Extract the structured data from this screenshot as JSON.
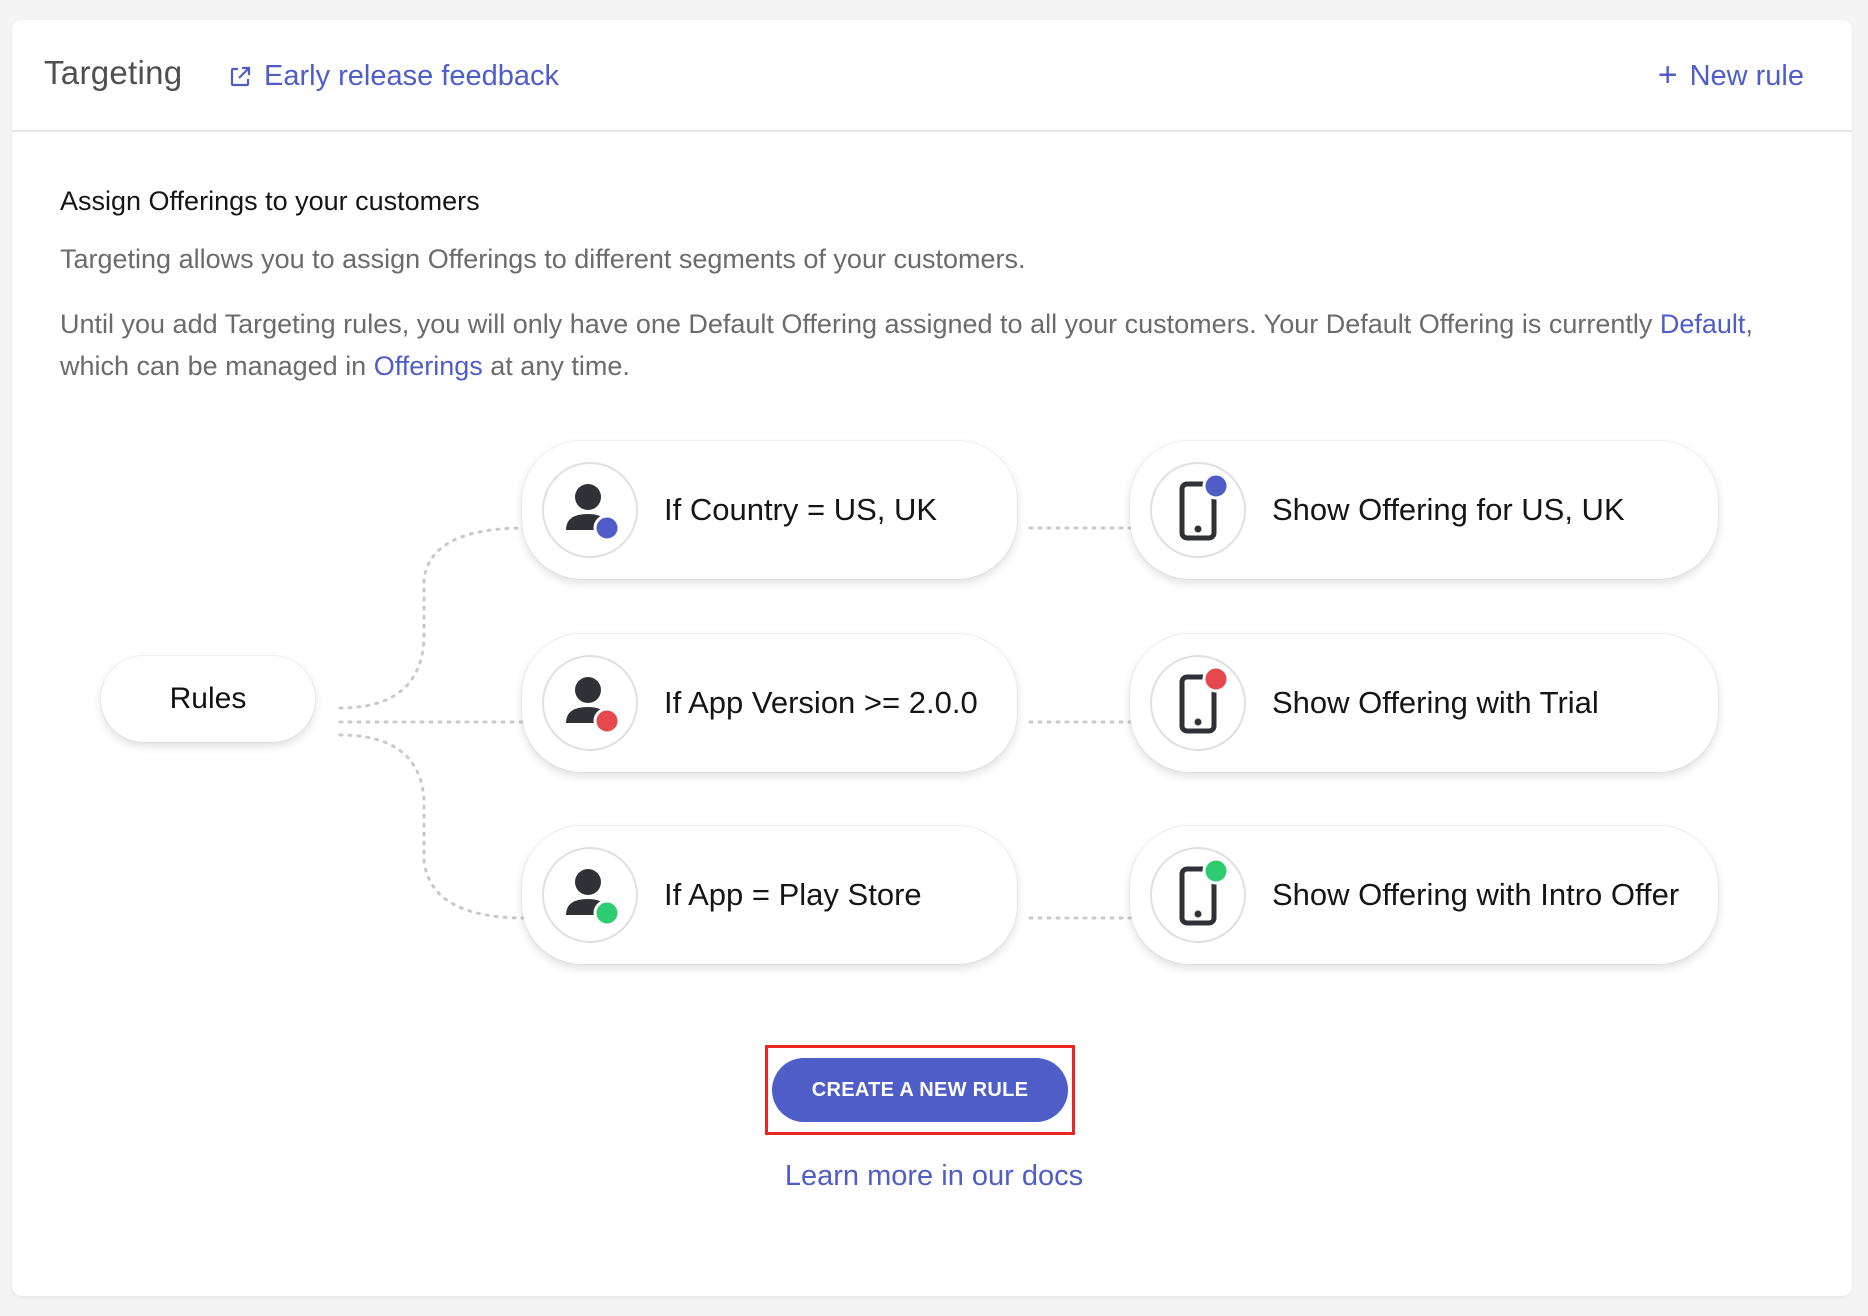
{
  "header": {
    "title": "Targeting",
    "feedback_label": "Early release feedback",
    "new_rule_label": "New rule"
  },
  "intro": {
    "title": "Assign Offerings to your customers",
    "paragraph1": "Targeting allows you to assign Offerings to different segments of your customers.",
    "paragraph2_before": "Until you add Targeting rules, you will only have one Default Offering assigned to all your customers. Your Default Offering is currently ",
    "default_link": "Default",
    "paragraph2_middle": ", which can be managed in ",
    "offerings_link": "Offerings",
    "paragraph2_after": " at any time."
  },
  "diagram": {
    "root_label": "Rules",
    "rows": [
      {
        "condition": "If Country = US, UK",
        "result": "Show Offering for US, UK",
        "dot_color": "#4f5dc9"
      },
      {
        "condition": "If App Version >= 2.0.0",
        "result": "Show Offering with Trial",
        "dot_color": "#e5484d"
      },
      {
        "condition": "If App = Play Store",
        "result": "Show Offering with Intro Offer",
        "dot_color": "#2ecc71"
      }
    ],
    "condition_icon": "user-icon",
    "result_icon": "phone-icon"
  },
  "cta": {
    "button_label": "CREATE A NEW RULE",
    "docs_link": "Learn more in our docs"
  },
  "colors": {
    "accent": "#4f5dc9",
    "highlight_border": "#e8281e"
  }
}
